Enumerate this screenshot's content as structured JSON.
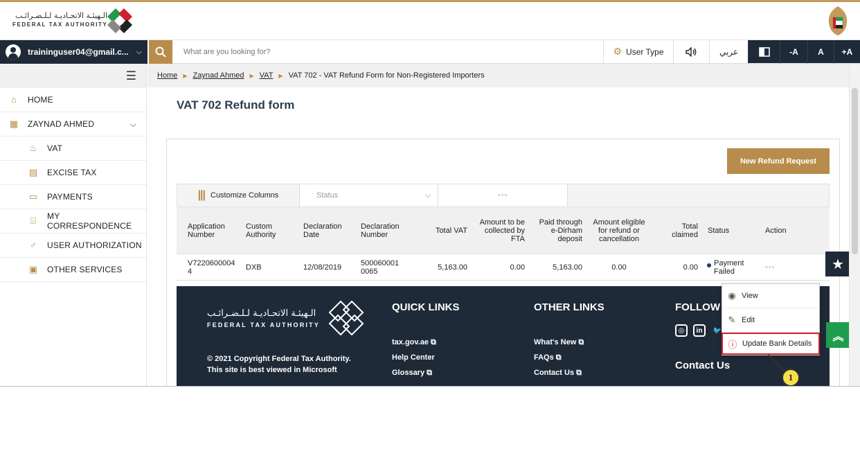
{
  "brand": {
    "logo_ar": "الـهيئـة الاتحـاديـة لـلـضـرائـب",
    "logo_en": "FEDERAL TAX AUTHORITY",
    "accent": "#b88c4a",
    "dark": "#1e2a38",
    "green": "#1f9d4d",
    "highlight": "#d0202a"
  },
  "nav": {
    "user_email": "traininguser04@gmail.c...",
    "search_placeholder": "What are you looking for?",
    "user_type": "User Type",
    "arabic": "عربي",
    "font_minus": "-A",
    "font_normal": "A",
    "font_plus": "+A",
    "icons": [
      "search-icon",
      "gear-icon",
      "speaker-icon",
      "contrast-icon"
    ]
  },
  "sidebar": {
    "items": [
      {
        "label": "HOME",
        "icon": "home-icon"
      },
      {
        "label": "ZAYNAD AHMED",
        "icon": "grid-icon"
      },
      {
        "label": "VAT",
        "icon": "vat-icon"
      },
      {
        "label": "EXCISE TAX",
        "icon": "excise-icon"
      },
      {
        "label": "PAYMENTS",
        "icon": "card-icon"
      },
      {
        "label": "MY CORRESPONDENCE",
        "icon": "building-icon"
      },
      {
        "label": "USER AUTHORIZATION",
        "icon": "user-key-icon"
      },
      {
        "label": "OTHER SERVICES",
        "icon": "clipboard-icon"
      }
    ]
  },
  "breadcrumb": {
    "home": "Home",
    "account": "Zaynad Ahmed",
    "vat": "VAT",
    "current": "VAT 702 - VAT Refund Form for Non-Registered Importers"
  },
  "page": {
    "title": "VAT 702 Refund form",
    "new_button": "New Refund Request"
  },
  "toolbar": {
    "customize": "Customize Columns",
    "status_placeholder": "Status",
    "more": "◦◦◦"
  },
  "table": {
    "headers": [
      "Application Number",
      "Custom Authority",
      "Declaration Date",
      "Declaration Number",
      "Total VAT",
      "Amount to be collected by FTA",
      "Paid through e-Dirham deposit",
      "Amount eligible for refund or cancellation",
      "Total claimed",
      "Status",
      "Action"
    ],
    "row": {
      "application_number": "V72206000044",
      "custom_authority": "DXB",
      "declaration_date": "12/08/2019",
      "declaration_number": "5000600010065",
      "total_vat": "5,163.00",
      "amount_collected": "0.00",
      "paid_edirham": "5,163.00",
      "amount_eligible": "0.00",
      "total_claimed": "0.00",
      "status": "Payment Failed",
      "action": "◦◦◦"
    }
  },
  "dropdown": {
    "view": "View",
    "edit": "Edit",
    "update_bank": "Update Bank Details"
  },
  "callout": {
    "number": "1"
  },
  "footer": {
    "ar": "الـهيئـة الاتحـاديـة لـلـضـرائـب",
    "en": "FEDERAL TAX AUTHORITY",
    "copyright_line1": "© 2021 Copyright Federal Tax Authority.",
    "copyright_line2": "This site is best viewed in Microsoft",
    "quick_links": "QUICK LINKS",
    "other_links": "OTHER LINKS",
    "follow": "FOLLOW",
    "contact": "Contact Us",
    "quick": [
      "tax.gov.ae",
      "Help Center",
      "Glossary"
    ],
    "other": [
      "What's New",
      "FAQs",
      "Contact Us"
    ]
  }
}
